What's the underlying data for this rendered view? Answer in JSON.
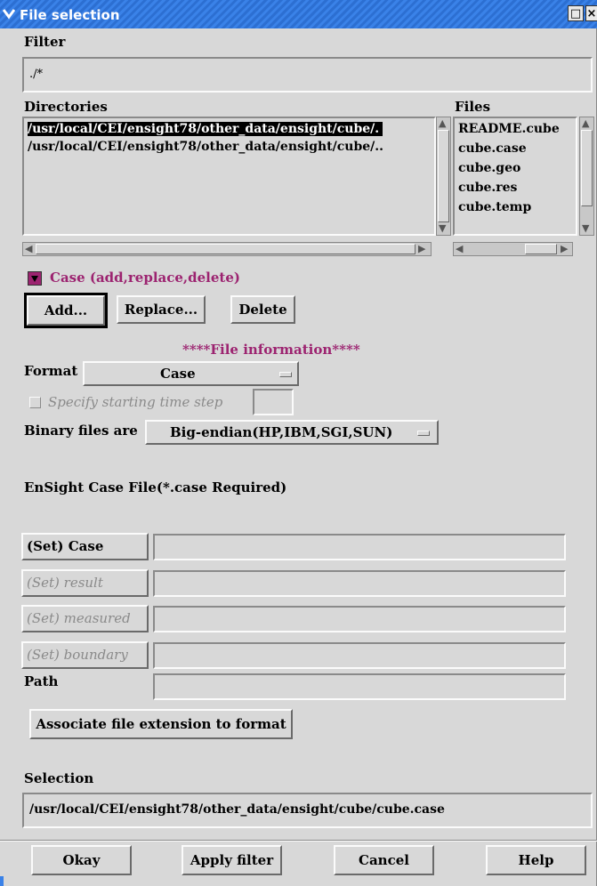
{
  "window": {
    "title": "File selection"
  },
  "filter": {
    "label": "Filter",
    "value": "./*"
  },
  "directories": {
    "label": "Directories",
    "items": [
      "/usr/local/CEI/ensight78/other_data/ensight/cube/.",
      "/usr/local/CEI/ensight78/other_data/ensight/cube/.."
    ]
  },
  "files": {
    "label": "Files",
    "items": [
      "README.cube",
      "cube.case",
      "cube.geo",
      "cube.res",
      "cube.temp"
    ]
  },
  "case_section": {
    "toggle_label": "Case (add,replace,delete)",
    "add": "Add...",
    "replace": "Replace...",
    "delete": "Delete"
  },
  "file_info": {
    "heading": "****File information****",
    "format_label": "Format",
    "format_value": "Case",
    "start_step_label": "Specify starting time step",
    "binary_label": "Binary files are",
    "binary_value": "Big-endian(HP,IBM,SGI,SUN)",
    "case_required": "EnSight Case File(*.case Required)"
  },
  "set_buttons": {
    "case": "(Set) Case",
    "result": "(Set) result",
    "measured": "(Set) measured",
    "boundary": "(Set) boundary"
  },
  "path_label": "Path",
  "associate_button": "Associate file extension to format",
  "selection": {
    "label": "Selection",
    "value": "/usr/local/CEI/ensight78/other_data/ensight/cube/cube.case"
  },
  "buttons": {
    "okay": "Okay",
    "apply": "Apply filter",
    "cancel": "Cancel",
    "help": "Help"
  },
  "colors": {
    "accent": "#9c2370",
    "titlebar": "#3a82e8",
    "panel": "#d8d8d8"
  }
}
